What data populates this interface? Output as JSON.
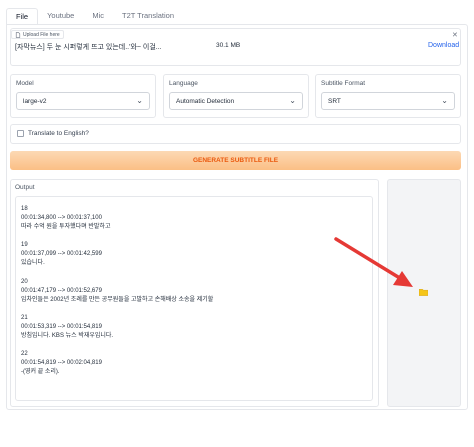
{
  "tabs": [
    {
      "label": "File",
      "active": true
    },
    {
      "label": "Youtube",
      "active": false
    },
    {
      "label": "Mic",
      "active": false
    },
    {
      "label": "T2T Translation",
      "active": false
    }
  ],
  "upload": {
    "label": "Upload File here",
    "file_name": "[자막뉴스] 두 눈 시퍼렇게 뜨고 있는데..'와~ 이걸...",
    "file_size": "30.1 MB",
    "download_label": "Download",
    "close_icon": "close-icon"
  },
  "model": {
    "label": "Model",
    "value": "large-v2"
  },
  "language": {
    "label": "Language",
    "value": "Automatic Detection"
  },
  "subtitle_format": {
    "label": "Subtitle Format",
    "value": "SRT"
  },
  "translate": {
    "label": "Translate to English?",
    "checked": false
  },
  "generate_button": {
    "label": "GENERATE SUBTITLE FILE"
  },
  "output": {
    "label": "Output",
    "entries": [
      {
        "index": "18",
        "time": "00:01:34,800 --> 00:01:37,100",
        "text": "따라 수억 원을 투자했다며 반발하고"
      },
      {
        "index": "19",
        "time": "00:01:37,099 --> 00:01:42,599",
        "text": "있습니다."
      },
      {
        "index": "20",
        "time": "00:01:47,179 --> 00:01:52,679",
        "text": "임차인들은 2002년 조례를 만든 공무원들을 고발하고 손해배상 소송을 제기할"
      },
      {
        "index": "21",
        "time": "00:01:53,319 --> 00:01:54,819",
        "text": "방침입니다. KBS 뉴스 박재우입니다."
      },
      {
        "index": "22",
        "time": "00:01:54,819 --> 00:02:04,819",
        "text": "-(영커 끝 소리)."
      }
    ]
  },
  "colors": {
    "accent_orange": "#ea580c",
    "button_gradient_top": "#fcd9b4",
    "button_gradient_bottom": "#fbbf85",
    "link_blue": "#2563eb",
    "arrow_red": "#e53935",
    "folder_yellow": "#f5c518"
  }
}
